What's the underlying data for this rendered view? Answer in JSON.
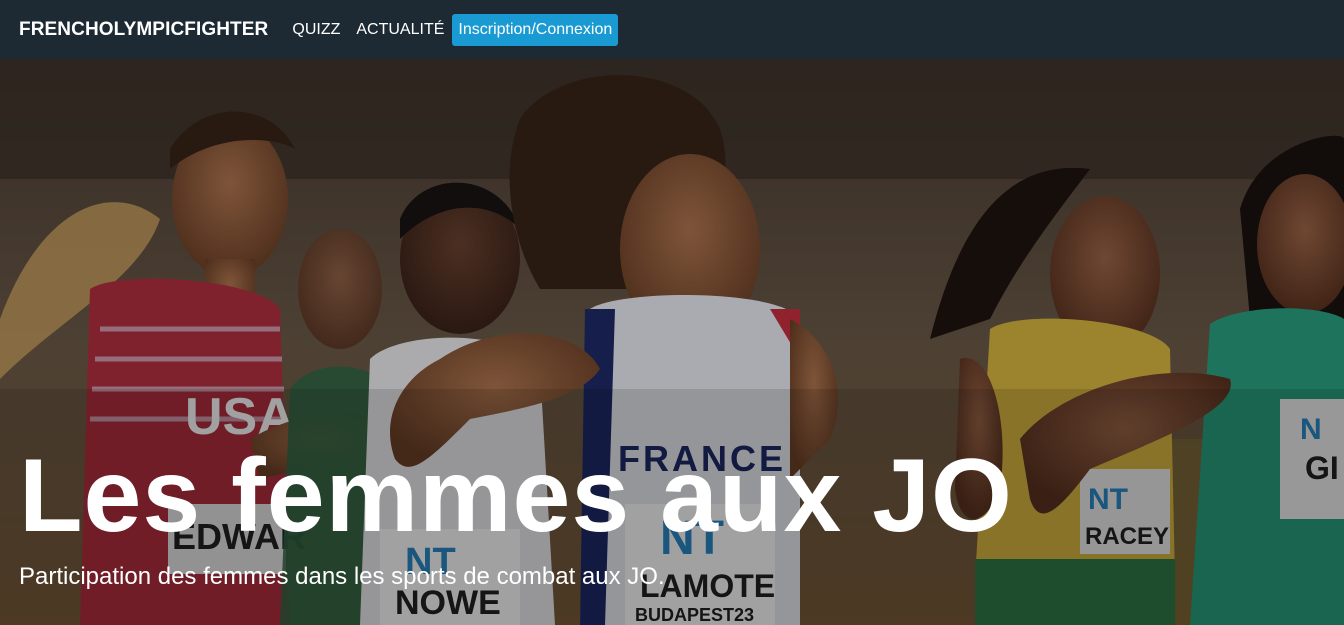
{
  "navbar": {
    "brand": "FRENCHOLYMPICFIGHTER",
    "links": [
      "QUIZZ",
      "ACTUALITÉ"
    ],
    "auth_button": "Inscription/Connexion"
  },
  "hero": {
    "title": "Les femmes aux JO",
    "subtitle": "Participation des femmes dans les sports de combat aux JO.",
    "image": {
      "bibs": [
        "USA",
        "EDWAR",
        "NOWE",
        "FRANCE",
        "LAMOTE",
        "RACEY",
        "GI",
        "BUDAPEST23"
      ]
    }
  },
  "colors": {
    "navbar_bg": "#1d2a33",
    "button_bg": "#1a9ad2",
    "text": "#ffffff"
  }
}
